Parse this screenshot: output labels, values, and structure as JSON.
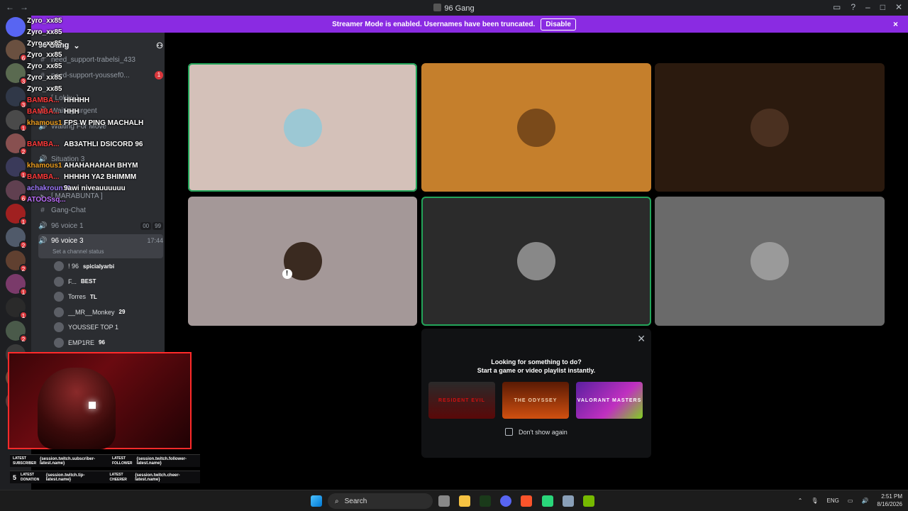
{
  "window": {
    "title": "96 Gang",
    "nav_back": "←",
    "nav_forward": "→"
  },
  "banner": {
    "text": "Streamer Mode is enabled. Usernames have been truncated.",
    "disable_label": "Disable",
    "close_icon": "×"
  },
  "server_rail": {
    "badges": [
      "6",
      "3",
      "3",
      "1",
      "2",
      "1",
      "6",
      "1",
      "2",
      "2",
      "1",
      "1",
      "2",
      "1",
      "1",
      "6"
    ]
  },
  "server": {
    "name": "96 Gang",
    "chevron": "⌄"
  },
  "channels": [
    {
      "name": "need_support-trabelsi_433",
      "badge": ""
    },
    {
      "name": "need-support-youssef0...",
      "badge": "1"
    },
    {
      "name": "[ Lobby ]",
      "badge": ""
    },
    {
      "name": "Waiting-urgent",
      "badge": ""
    },
    {
      "name": "Waiting For Move",
      "badge": ""
    },
    {
      "name": "Situation 3",
      "badge": ""
    },
    {
      "name": "[ MARABUNTA ]",
      "badge": ""
    },
    {
      "name": "Gang-Chat",
      "badge": ""
    },
    {
      "name": "96 voice 1",
      "pills": [
        "00",
        "99"
      ]
    },
    {
      "name": "96 voice 3",
      "time": "17:44",
      "status": "Set a channel status"
    }
  ],
  "voice_users": [
    {
      "name": "! 96",
      "tag": "spicialyarbi"
    },
    {
      "name": "F...",
      "tag": "BEST"
    },
    {
      "name": "Torres",
      "tag": "TL"
    },
    {
      "name": "__MR__Monkey",
      "tag": "29"
    },
    {
      "name": "YOUSSEF TOP 1",
      "tag": ""
    },
    {
      "name": "EMP1RE",
      "tag": "96"
    }
  ],
  "chat": [
    {
      "user": "Zyro_xx85",
      "text": "",
      "color": "#ffffff"
    },
    {
      "user": "Zyro_xx85",
      "text": "",
      "color": "#ffffff"
    },
    {
      "user": "Zyro_xx85",
      "text": "",
      "color": "#ffffff"
    },
    {
      "user": "Zyro_xx85",
      "text": "",
      "color": "#ffffff"
    },
    {
      "user": "Zyro_xx85",
      "text": "",
      "color": "#ffffff"
    },
    {
      "user": "Zyro_xx85",
      "text": "",
      "color": "#ffffff"
    },
    {
      "user": "Zyro_xx85",
      "text": "",
      "color": "#ffffff"
    },
    {
      "user": "BAMBA...",
      "text": "HHHHH",
      "color": "#ff3b3b"
    },
    {
      "user": "BAMBA...",
      "text": "HHH",
      "color": "#ff3b3b"
    },
    {
      "user": "khamous1",
      "text": "FPS W PING MACHALH",
      "color": "#f0a020"
    },
    {
      "user": "BAMBA...",
      "text": "AB3ATHLI DSICORD 96",
      "color": "#ff3b3b"
    },
    {
      "user": "khamous1",
      "text": "AHAHAHAHAH BHYM",
      "color": "#f0a020"
    },
    {
      "user": "BAMBA...",
      "text": "HHHHH YA2 BHIMMM",
      "color": "#ff3b3b"
    },
    {
      "user": "achakroun19",
      "text": "9awi niveauuuuuu",
      "color": "#a07aff"
    },
    {
      "user": "ATOOSsq...",
      "text": "",
      "color": "#c070ff"
    }
  ],
  "tiles": [
    {
      "bg": "#d4c1b9",
      "avatar": "#9cc8d4",
      "speaking": true
    },
    {
      "bg": "#c57f2c",
      "avatar": "#7a4a1a",
      "speaking": false
    },
    {
      "bg": "#2b1a0e",
      "avatar": "#4a3020",
      "speaking": false
    },
    {
      "bg": "#a49898",
      "avatar": "#3a2a20",
      "speaking": false,
      "muted": true
    },
    {
      "bg": "#2b2b2b",
      "avatar": "#888888",
      "speaking": true
    },
    {
      "bg": "#6a6a6a",
      "avatar": "#9a9a9a",
      "speaking": false
    }
  ],
  "activity": {
    "title": "Looking for something to do?",
    "subtitle": "Start a game or video playlist instantly.",
    "games": [
      "RESIDENT EVIL",
      "THE ODYSSEY",
      "VALORANT MASTERS"
    ],
    "checkbox_label": "Don't show again",
    "close_icon": "✕"
  },
  "widgets": [
    {
      "label": "LATEST SUBSCRIBER",
      "value": "{session.twitch.subscriber-latest.name}",
      "label2": "LATEST FOLLOWER",
      "value2": "{session.twitch.follower-latest.name}"
    },
    {
      "label": "LATEST DONATION",
      "value": "{session.twitch.tip-latest.name}",
      "label2": "LATEST CHEERER",
      "value2": "{session.twitch.cheer-latest.name}"
    }
  ],
  "widget_counter": "5",
  "taskbar": {
    "search": "Search",
    "lang": "ENG",
    "time": "2:51 PM",
    "date": "8/16/2026"
  }
}
